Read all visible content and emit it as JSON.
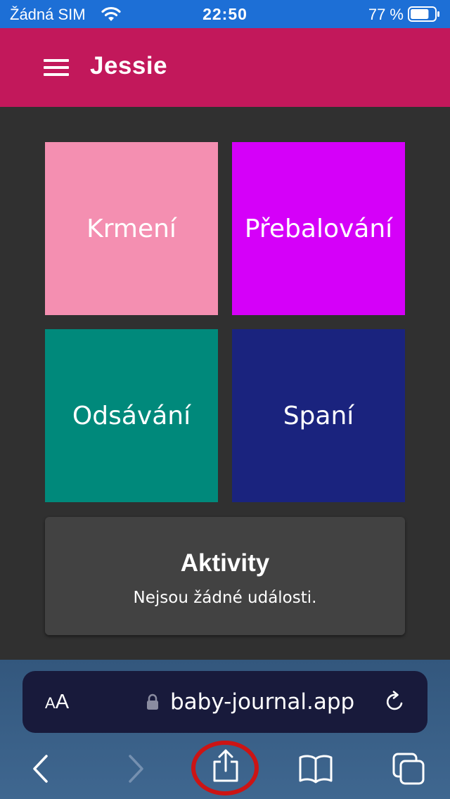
{
  "status_bar": {
    "carrier": "Žádná SIM",
    "time": "22:50",
    "battery_percent": "77 %",
    "battery_level": 0.77
  },
  "app_bar": {
    "title": "Jessie",
    "menu_icon": "hamburger-menu-icon"
  },
  "tiles": [
    {
      "label": "Krmení",
      "color": "#f48fb1"
    },
    {
      "label": "Přebalování",
      "color": "#d500f9"
    },
    {
      "label": "Odsávání",
      "color": "#00897b"
    },
    {
      "label": "Spaní",
      "color": "#1a237e"
    }
  ],
  "activity_card": {
    "title": "Aktivity",
    "text": "Nejsou žádné události."
  },
  "browser": {
    "text_size_small": "A",
    "text_size_big": "A",
    "url": "baby-journal.app",
    "icons": [
      "text-size-icon",
      "lock-icon",
      "reload-icon",
      "back-icon",
      "forward-icon",
      "share-icon",
      "bookmarks-icon",
      "tabs-icon"
    ]
  },
  "colors": {
    "status_bar": "#1d6fd6",
    "app_bar": "#c2185b",
    "background": "#303030",
    "card": "#424242",
    "highlight": "#cc1414"
  }
}
